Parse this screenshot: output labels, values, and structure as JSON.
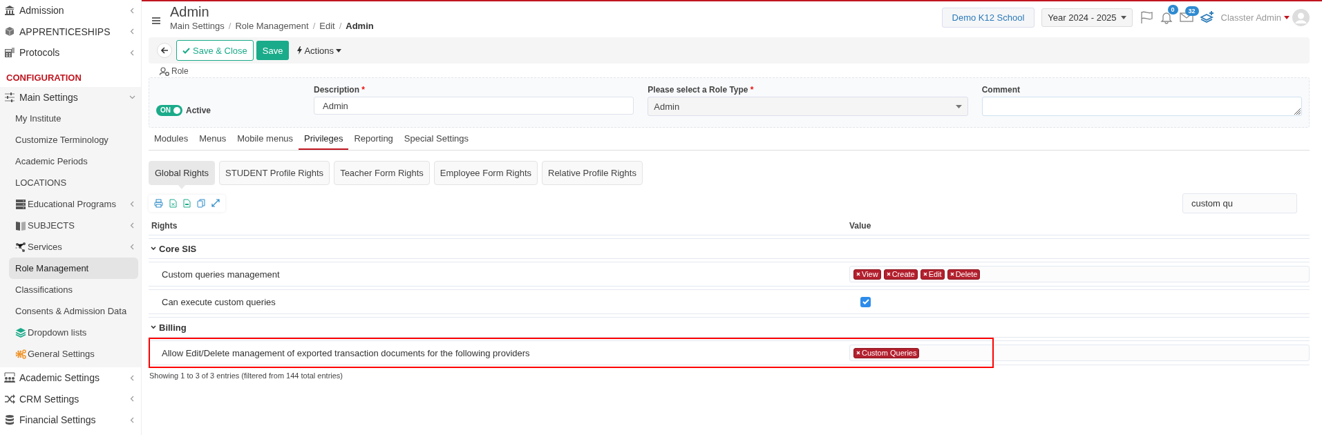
{
  "sidebar": {
    "items": [
      {
        "kind": "item",
        "label": "Admission",
        "expanded": false,
        "selected": false
      },
      {
        "kind": "item",
        "label": "APPRENTICESHIPS",
        "expanded": false,
        "selected": false
      },
      {
        "kind": "item",
        "label": "Protocols",
        "expanded": false,
        "selected": false
      },
      {
        "kind": "section",
        "label": "CONFIGURATION"
      },
      {
        "kind": "item",
        "label": "Main Settings",
        "expanded": true,
        "selected": false,
        "children": [
          {
            "label": "My Institute",
            "selected": false
          },
          {
            "label": "Customize Terminology",
            "selected": false
          },
          {
            "label": "Academic Periods",
            "selected": false
          },
          {
            "label": "LOCATIONS",
            "selected": false
          },
          {
            "label": "Educational Programs",
            "expanded": false,
            "selected": false
          },
          {
            "label": "SUBJECTS",
            "expanded": false,
            "selected": false
          },
          {
            "label": "Services",
            "expanded": false,
            "selected": false
          },
          {
            "label": "Role Management",
            "selected": true
          },
          {
            "label": "Classifications",
            "selected": false
          },
          {
            "label": "Consents & Admission Data",
            "selected": false
          },
          {
            "label": "Dropdown lists",
            "selected": false
          },
          {
            "label": "General Settings",
            "selected": false
          }
        ]
      },
      {
        "kind": "item",
        "label": "Academic Settings",
        "expanded": false,
        "selected": false
      },
      {
        "kind": "item",
        "label": "CRM Settings",
        "expanded": false,
        "selected": false
      },
      {
        "kind": "item",
        "label": "Financial Settings",
        "expanded": false,
        "selected": false
      }
    ]
  },
  "header": {
    "title": "Admin",
    "breadcrumb": [
      {
        "label": "Main Settings",
        "separator": "/"
      },
      {
        "label": "Role Management",
        "separator": "/"
      },
      {
        "label": "Edit",
        "separator": "/"
      },
      {
        "label": "Admin"
      }
    ],
    "school": "Demo K12 School",
    "year": "Year 2024 - 2025",
    "notifications": "0",
    "messages": "32",
    "user": "Classter Admin"
  },
  "toolbar": {
    "save_close": "Save & Close",
    "save": "Save",
    "actions": "Actions"
  },
  "role": {
    "legend": "Role",
    "active": {
      "switch": "ON",
      "on": true,
      "label": "Active"
    },
    "fields": [
      {
        "kind": "input",
        "label": "Description",
        "required_mark": "*",
        "value": "Admin"
      },
      {
        "kind": "select",
        "label": "Please select a Role Type",
        "required_mark": "*",
        "value": "Admin"
      },
      {
        "kind": "textarea",
        "label": "Comment"
      }
    ]
  },
  "tabs": [
    {
      "label": "Modules",
      "selected": false
    },
    {
      "label": "Menus",
      "selected": false
    },
    {
      "label": "Mobile menus",
      "selected": false
    },
    {
      "label": "Privileges",
      "selected": true
    },
    {
      "label": "Reporting",
      "selected": false
    },
    {
      "label": "Special Settings",
      "selected": false
    }
  ],
  "subtabs": [
    {
      "label": "Global Rights",
      "selected": true
    },
    {
      "label": "STUDENT Profile Rights",
      "selected": false
    },
    {
      "label": "Teacher Form Rights",
      "selected": false
    },
    {
      "label": "Employee Form Rights",
      "selected": false
    },
    {
      "label": "Relative Profile Rights",
      "selected": false
    }
  ],
  "search": {
    "value": "custom qu"
  },
  "table": {
    "columns": [
      "Rights",
      "Value"
    ],
    "rows": [
      {
        "kind": "group",
        "label": "Core SIS",
        "expanded": true
      },
      {
        "kind": "tags",
        "label": "Custom queries management",
        "tags": [
          "View",
          "Create",
          "Edit",
          "Delete"
        ]
      },
      {
        "kind": "checkbox",
        "label": "Can execute custom queries",
        "checked": true
      },
      {
        "kind": "group",
        "label": "Billing",
        "expanded": true
      },
      {
        "kind": "tags",
        "label": "Allow Edit/Delete management of exported transaction documents for the following providers",
        "tags": [
          "Custom Queries"
        ],
        "highlighted": true
      }
    ],
    "footer": "Showing 1 to 3 of 3 entries (filtered from 144 total entries)"
  }
}
